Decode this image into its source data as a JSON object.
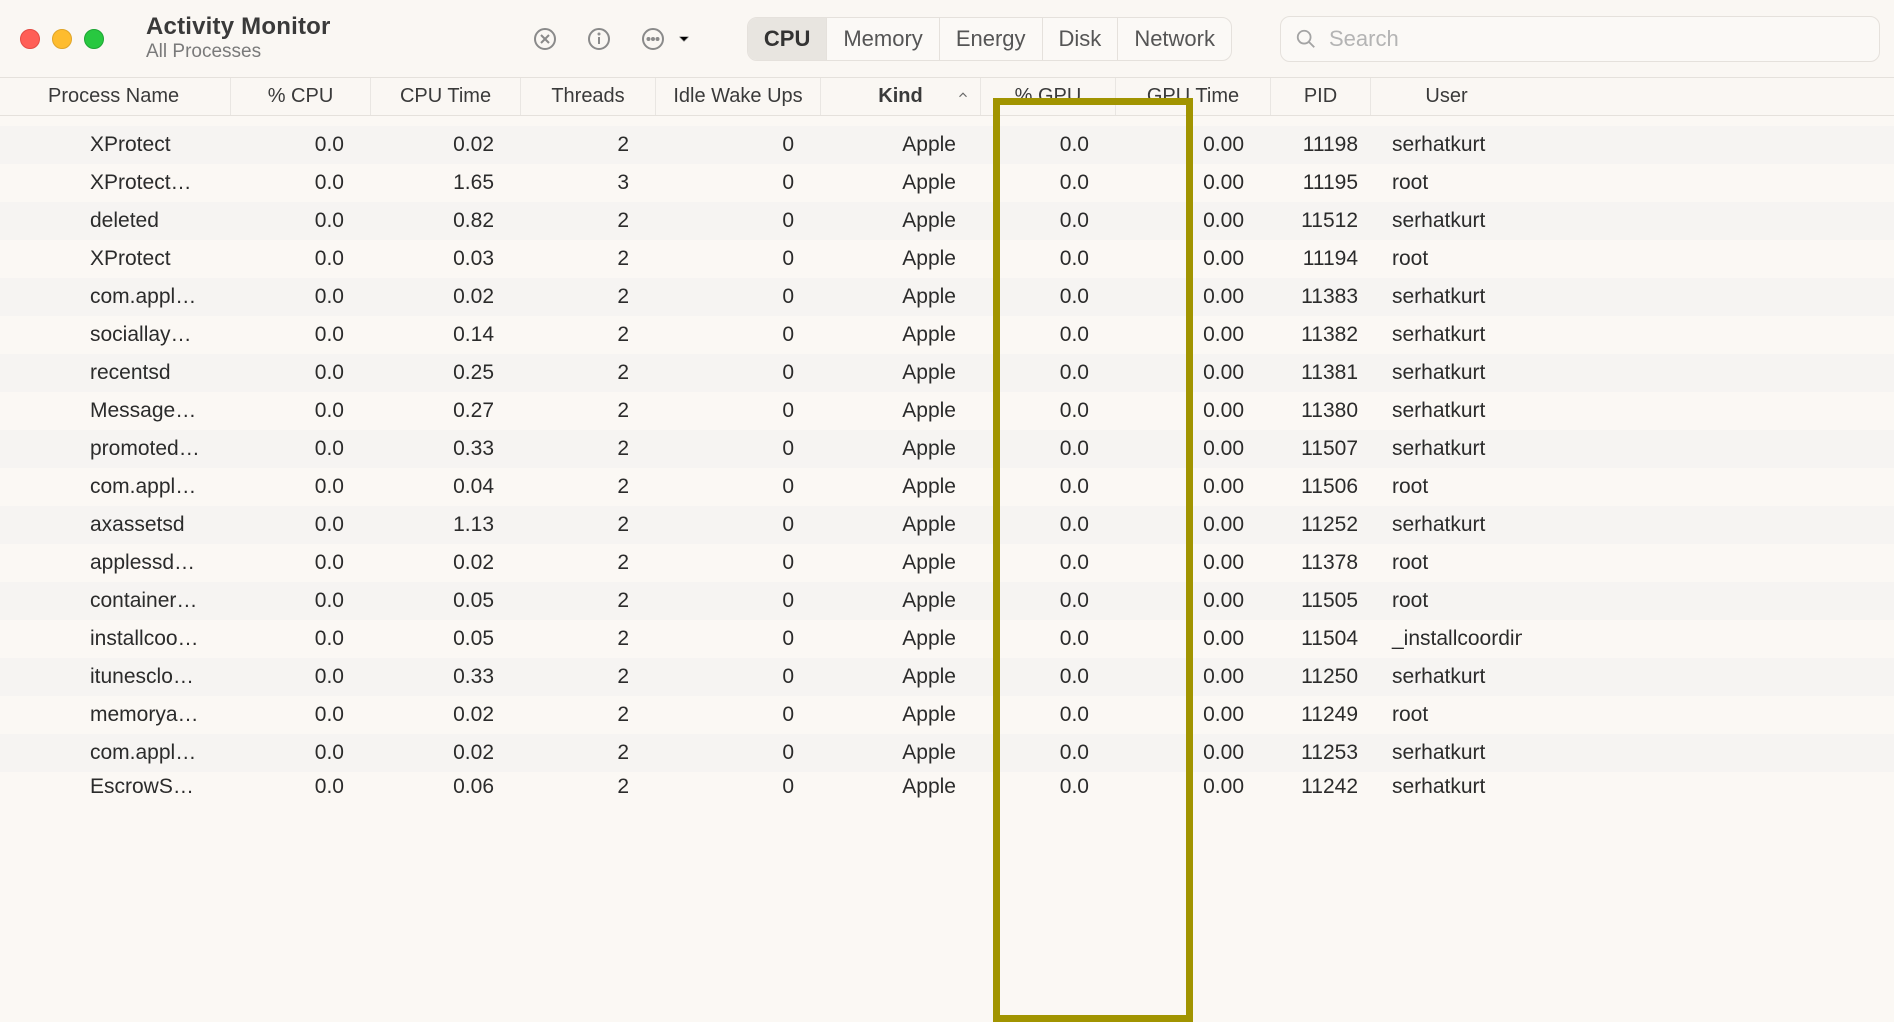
{
  "window": {
    "title": "Activity Monitor",
    "subtitle": "All Processes"
  },
  "toolbar": {
    "tabs": [
      "CPU",
      "Memory",
      "Energy",
      "Disk",
      "Network"
    ],
    "active_tab": "CPU",
    "search_placeholder": "Search"
  },
  "columns": [
    {
      "key": "name",
      "label": "Process Name",
      "align": "left"
    },
    {
      "key": "cpu",
      "label": "% CPU",
      "align": "right"
    },
    {
      "key": "cputime",
      "label": "CPU Time",
      "align": "right"
    },
    {
      "key": "threads",
      "label": "Threads",
      "align": "right"
    },
    {
      "key": "idlewake",
      "label": "Idle Wake Ups",
      "align": "right"
    },
    {
      "key": "kind",
      "label": "Kind",
      "align": "right",
      "sorted": "asc"
    },
    {
      "key": "gpu",
      "label": "% GPU",
      "align": "right"
    },
    {
      "key": "gputime",
      "label": "GPU Time",
      "align": "right"
    },
    {
      "key": "pid",
      "label": "PID",
      "align": "right"
    },
    {
      "key": "user",
      "label": "User",
      "align": "left"
    }
  ],
  "rows": [
    {
      "name": "XProtect",
      "cpu": "0.0",
      "cputime": "0.02",
      "threads": "2",
      "idlewake": "0",
      "kind": "Apple",
      "gpu": "0.0",
      "gputime": "0.00",
      "pid": "11198",
      "user": "serhatkurt"
    },
    {
      "name": "XProtect…",
      "cpu": "0.0",
      "cputime": "1.65",
      "threads": "3",
      "idlewake": "0",
      "kind": "Apple",
      "gpu": "0.0",
      "gputime": "0.00",
      "pid": "11195",
      "user": "root"
    },
    {
      "name": "deleted",
      "cpu": "0.0",
      "cputime": "0.82",
      "threads": "2",
      "idlewake": "0",
      "kind": "Apple",
      "gpu": "0.0",
      "gputime": "0.00",
      "pid": "11512",
      "user": "serhatkurt"
    },
    {
      "name": "XProtect",
      "cpu": "0.0",
      "cputime": "0.03",
      "threads": "2",
      "idlewake": "0",
      "kind": "Apple",
      "gpu": "0.0",
      "gputime": "0.00",
      "pid": "11194",
      "user": "root"
    },
    {
      "name": "com.appl…",
      "cpu": "0.0",
      "cputime": "0.02",
      "threads": "2",
      "idlewake": "0",
      "kind": "Apple",
      "gpu": "0.0",
      "gputime": "0.00",
      "pid": "11383",
      "user": "serhatkurt"
    },
    {
      "name": "sociallay…",
      "cpu": "0.0",
      "cputime": "0.14",
      "threads": "2",
      "idlewake": "0",
      "kind": "Apple",
      "gpu": "0.0",
      "gputime": "0.00",
      "pid": "11382",
      "user": "serhatkurt"
    },
    {
      "name": "recentsd",
      "cpu": "0.0",
      "cputime": "0.25",
      "threads": "2",
      "idlewake": "0",
      "kind": "Apple",
      "gpu": "0.0",
      "gputime": "0.00",
      "pid": "11381",
      "user": "serhatkurt"
    },
    {
      "name": "Message…",
      "cpu": "0.0",
      "cputime": "0.27",
      "threads": "2",
      "idlewake": "0",
      "kind": "Apple",
      "gpu": "0.0",
      "gputime": "0.00",
      "pid": "11380",
      "user": "serhatkurt"
    },
    {
      "name": "promoted…",
      "cpu": "0.0",
      "cputime": "0.33",
      "threads": "2",
      "idlewake": "0",
      "kind": "Apple",
      "gpu": "0.0",
      "gputime": "0.00",
      "pid": "11507",
      "user": "serhatkurt"
    },
    {
      "name": "com.appl…",
      "cpu": "0.0",
      "cputime": "0.04",
      "threads": "2",
      "idlewake": "0",
      "kind": "Apple",
      "gpu": "0.0",
      "gputime": "0.00",
      "pid": "11506",
      "user": "root"
    },
    {
      "name": "axassetsd",
      "cpu": "0.0",
      "cputime": "1.13",
      "threads": "2",
      "idlewake": "0",
      "kind": "Apple",
      "gpu": "0.0",
      "gputime": "0.00",
      "pid": "11252",
      "user": "serhatkurt"
    },
    {
      "name": "applessd…",
      "cpu": "0.0",
      "cputime": "0.02",
      "threads": "2",
      "idlewake": "0",
      "kind": "Apple",
      "gpu": "0.0",
      "gputime": "0.00",
      "pid": "11378",
      "user": "root"
    },
    {
      "name": "container…",
      "cpu": "0.0",
      "cputime": "0.05",
      "threads": "2",
      "idlewake": "0",
      "kind": "Apple",
      "gpu": "0.0",
      "gputime": "0.00",
      "pid": "11505",
      "user": "root"
    },
    {
      "name": "installcoo…",
      "cpu": "0.0",
      "cputime": "0.05",
      "threads": "2",
      "idlewake": "0",
      "kind": "Apple",
      "gpu": "0.0",
      "gputime": "0.00",
      "pid": "11504",
      "user": "_installcoordin"
    },
    {
      "name": "itunesclo…",
      "cpu": "0.0",
      "cputime": "0.33",
      "threads": "2",
      "idlewake": "0",
      "kind": "Apple",
      "gpu": "0.0",
      "gputime": "0.00",
      "pid": "11250",
      "user": "serhatkurt"
    },
    {
      "name": "memorya…",
      "cpu": "0.0",
      "cputime": "0.02",
      "threads": "2",
      "idlewake": "0",
      "kind": "Apple",
      "gpu": "0.0",
      "gputime": "0.00",
      "pid": "11249",
      "user": "root"
    },
    {
      "name": "com.appl…",
      "cpu": "0.0",
      "cputime": "0.02",
      "threads": "2",
      "idlewake": "0",
      "kind": "Apple",
      "gpu": "0.0",
      "gputime": "0.00",
      "pid": "11253",
      "user": "serhatkurt"
    },
    {
      "name": "EscrowS…",
      "cpu": "0.0",
      "cputime": "0.06",
      "threads": "2",
      "idlewake": "0",
      "kind": "Apple",
      "gpu": "0.0",
      "gputime": "0.00",
      "pid": "11242",
      "user": "serhatkurt"
    }
  ]
}
